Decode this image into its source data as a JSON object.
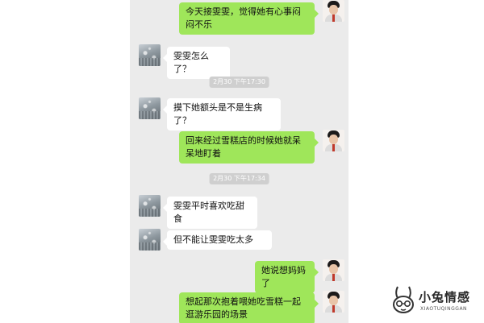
{
  "messages": [
    {
      "side": "right",
      "text": "今天接雯雯，觉得她有心事闷闷不乐"
    },
    {
      "side": "left",
      "text": "雯雯怎么了？"
    },
    {
      "type": "time",
      "text": "2月30 下午17:30"
    },
    {
      "side": "left",
      "text": "摸下她额头是不是生病了？"
    },
    {
      "side": "right",
      "text": "回来经过雪糕店的时候她就呆呆地盯着"
    },
    {
      "type": "time",
      "text": "2月30 下午17:34"
    },
    {
      "side": "left",
      "text": "雯雯平时喜欢吃甜食"
    },
    {
      "side": "left",
      "text": "但不能让雯雯吃太多"
    },
    {
      "side": "right",
      "text": "她说想妈妈了"
    },
    {
      "side": "right",
      "text": "想起那次抱着喂她吃雪糕一起逛游乐园的场景"
    }
  ],
  "watermark": {
    "title": "小兔情感",
    "subtitle": "XIAOTUQINGGAN"
  },
  "colors": {
    "chat_background": "#ebebeb",
    "sent_bubble": "#9fe65a",
    "received_bubble": "#ffffff",
    "timestamp_pill": "#cfcfcf"
  }
}
